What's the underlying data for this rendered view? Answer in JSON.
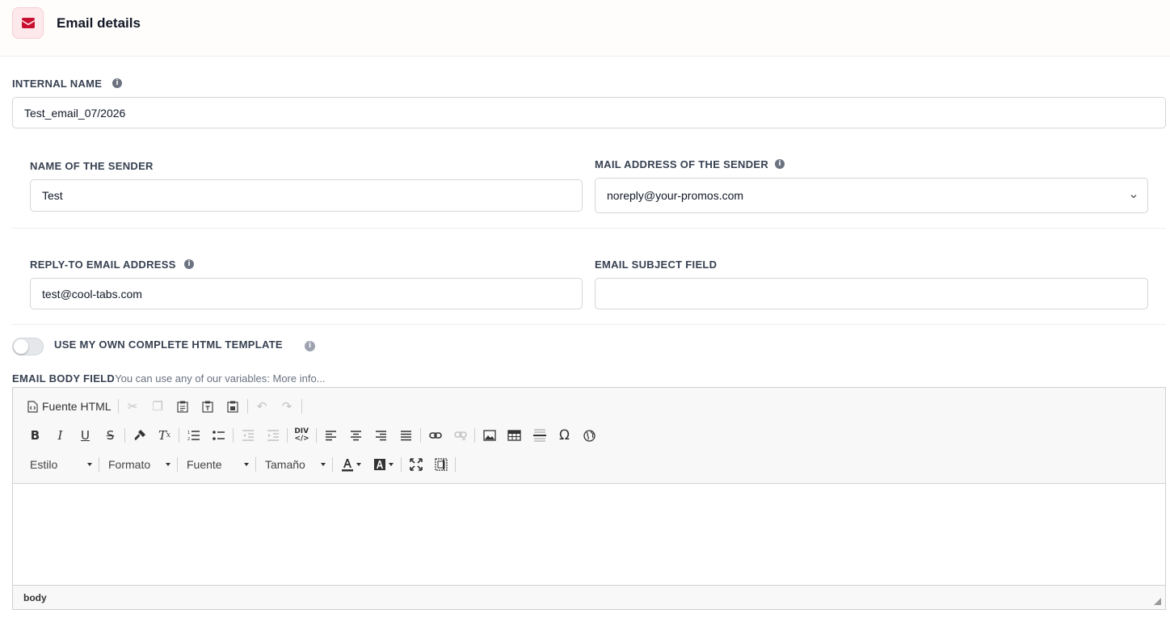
{
  "header": {
    "title": "Email details",
    "icon": "envelope-icon",
    "icon_color": "#c8102e"
  },
  "internal_name": {
    "label": "INTERNAL NAME",
    "value": "Test_email_07/2026"
  },
  "sender_name": {
    "label": "NAME OF THE SENDER",
    "value": "Test"
  },
  "sender_address": {
    "label": "MAIL ADDRESS OF THE SENDER",
    "value": "noreply@your-promos.com"
  },
  "reply_to": {
    "label": "REPLY-TO EMAIL ADDRESS",
    "value": "test@cool-tabs.com"
  },
  "subject": {
    "label": "EMAIL SUBJECT FIELD",
    "value": ""
  },
  "html_template": {
    "label": "USE MY OWN COMPLETE HTML TEMPLATE",
    "enabled": false
  },
  "body": {
    "label": "EMAIL BODY FIELD",
    "hint": "You can use any of our variables: ",
    "more_link": "More info..."
  },
  "editor": {
    "source_label": "Fuente HTML",
    "combos": {
      "style": "Estilo",
      "format": "Formato",
      "font": "Fuente",
      "size": "Tamaño"
    },
    "status_path": "body"
  }
}
